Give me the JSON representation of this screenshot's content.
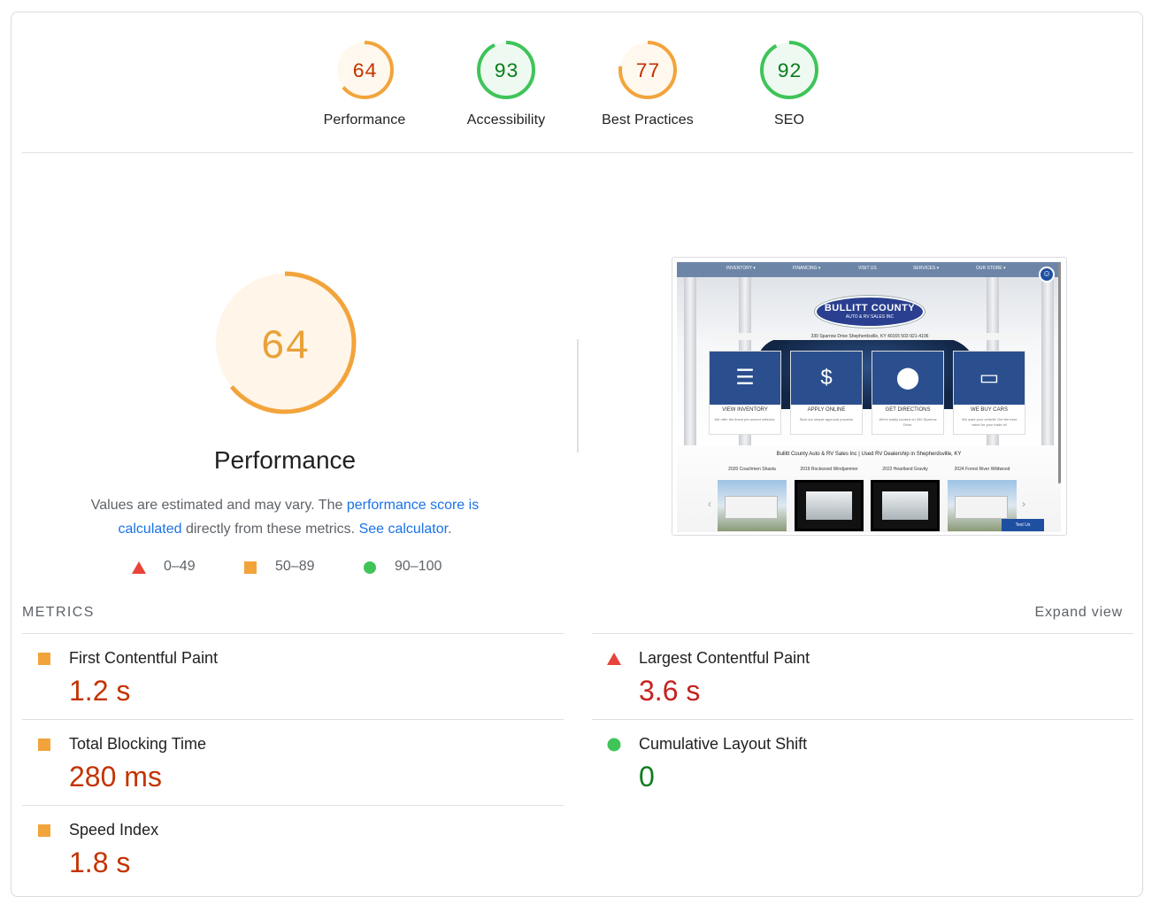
{
  "colors": {
    "fail": "#ff4e42",
    "average": "#ffa400",
    "pass": "#0cce6b",
    "link": "#1a73e8"
  },
  "gauges": [
    {
      "score": "64",
      "label": "Performance",
      "rating": "average"
    },
    {
      "score": "93",
      "label": "Accessibility",
      "rating": "pass"
    },
    {
      "score": "77",
      "label": "Best Practices",
      "rating": "average"
    },
    {
      "score": "92",
      "label": "SEO",
      "rating": "pass"
    }
  ],
  "performance": {
    "score": "64",
    "title": "Performance",
    "desc_prefix": "Values are estimated and may vary. The ",
    "desc_link1": "performance score is calculated",
    "desc_middle": " directly from these metrics. ",
    "desc_link2": "See calculator",
    "desc_suffix": "."
  },
  "legend": [
    {
      "icon": "triangle-icon",
      "range": "0–49"
    },
    {
      "icon": "square-icon",
      "range": "50–89"
    },
    {
      "icon": "circle-icon",
      "range": "90–100"
    }
  ],
  "screenshot": {
    "nav": [
      "INVENTORY ▾",
      "FINANCING ▾",
      "VISIT US",
      "SERVICES ▾",
      "OUR STORE ▾"
    ],
    "logo_line1": "BULLITT COUNTY",
    "logo_line2": "AUTO & RV SALES INC",
    "address": "330 Sparrow Drive Shepherdsville, KY 40165   502-921-4106",
    "tiles": [
      {
        "icon": "list-icon",
        "title": "VIEW INVENTORY",
        "sub": "We offer the finest pre-owned vehicles."
      },
      {
        "icon": "dollar-doc-icon",
        "title": "APPLY ONLINE",
        "sub": "Start our simple approval process!"
      },
      {
        "icon": "map-pin-icon",
        "title": "GET DIRECTIONS",
        "sub": "We're easily located on 330 Sparrow Drive."
      },
      {
        "icon": "car-icon",
        "title": "WE BUY CARS",
        "sub": "We want your vehicle! Get the best value for your trade-in!"
      }
    ],
    "heading": "Bullitt County Auto & RV Sales Inc | Used RV Dealership in Shepherdsville, KY",
    "rvs": [
      "2020 Coachmen Shasta",
      "2019 Rockwood Windjammer",
      "2022 Heartland Gravity",
      "2024 Forest River Wildwood"
    ],
    "text_us": "Text Us"
  },
  "metrics": {
    "heading": "METRICS",
    "expand": "Expand view",
    "items": [
      {
        "label": "First Contentful Paint",
        "value": "1.2 s",
        "rating": "average"
      },
      {
        "label": "Largest Contentful Paint",
        "value": "3.6 s",
        "rating": "fail"
      },
      {
        "label": "Total Blocking Time",
        "value": "280 ms",
        "rating": "average"
      },
      {
        "label": "Cumulative Layout Shift",
        "value": "0",
        "rating": "pass"
      },
      {
        "label": "Speed Index",
        "value": "1.8 s",
        "rating": "average"
      }
    ]
  }
}
